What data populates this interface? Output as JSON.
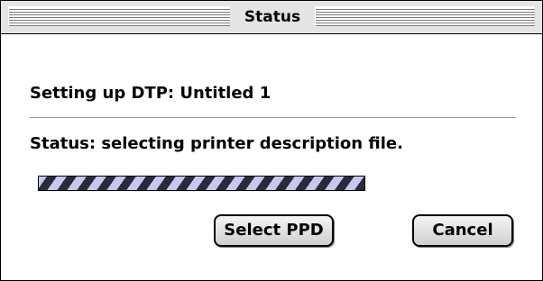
{
  "window": {
    "title": "Status"
  },
  "dialog": {
    "heading": "Setting up DTP: Untitled 1",
    "status_text": "Status: selecting printer description file.",
    "progress": "indeterminate"
  },
  "buttons": {
    "select_ppd": "Select PPD",
    "cancel": "Cancel"
  },
  "colors": {
    "progress_dark": "#2a2a3c",
    "progress_light": "#c7c8ef"
  }
}
